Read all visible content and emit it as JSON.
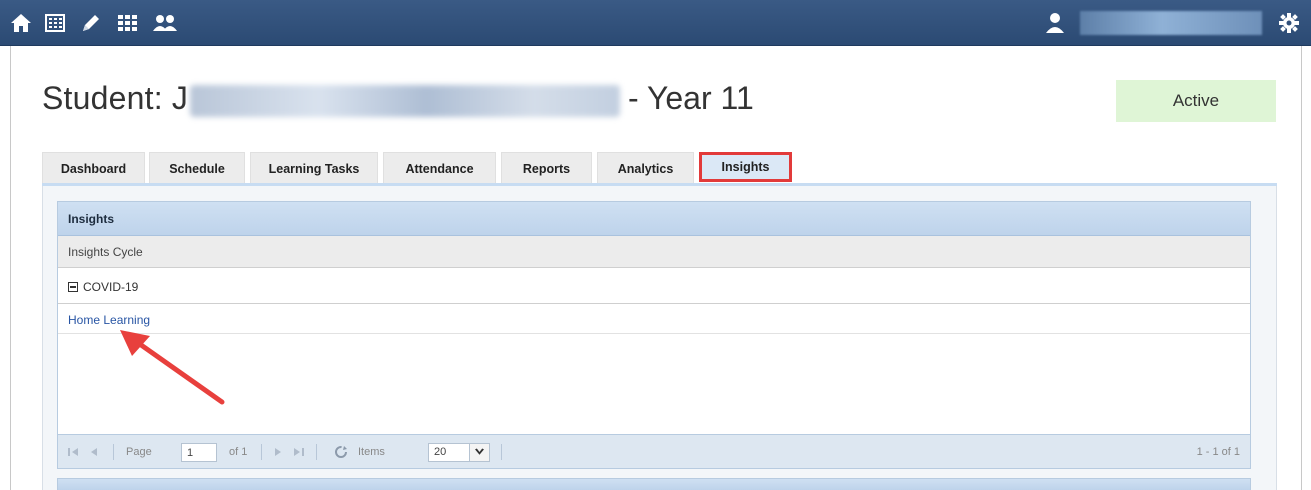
{
  "nav": {
    "icons": [
      "home-icon",
      "calendar-grid-icon",
      "pencil-icon",
      "apps-grid-icon",
      "people-icon"
    ],
    "user_icon": "user-icon",
    "settings_icon": "gear-icon"
  },
  "student": {
    "prefix": "Student: J",
    "year": "- Year 11",
    "status": "Active"
  },
  "tabs": [
    {
      "label": "Dashboard"
    },
    {
      "label": "Schedule"
    },
    {
      "label": "Learning Tasks"
    },
    {
      "label": "Attendance"
    },
    {
      "label": "Reports"
    },
    {
      "label": "Analytics"
    },
    {
      "label": "Insights",
      "active": true
    }
  ],
  "grid": {
    "title": "Insights",
    "column_header": "Insights Cycle",
    "group_label": "COVID-19",
    "rows": [
      {
        "name": "Home Learning"
      }
    ]
  },
  "pager": {
    "page_label": "Page",
    "page_value": "1",
    "of_label": "of 1",
    "items_label": "Items",
    "items_value": "20",
    "summary": "1 - 1 of 1"
  },
  "colors": {
    "topbar": "#2f4f7a",
    "active_tab_border": "#e23a3a",
    "annotation_arrow": "#e8403d",
    "status_bg": "#dff5d6",
    "link": "#2855a4"
  }
}
